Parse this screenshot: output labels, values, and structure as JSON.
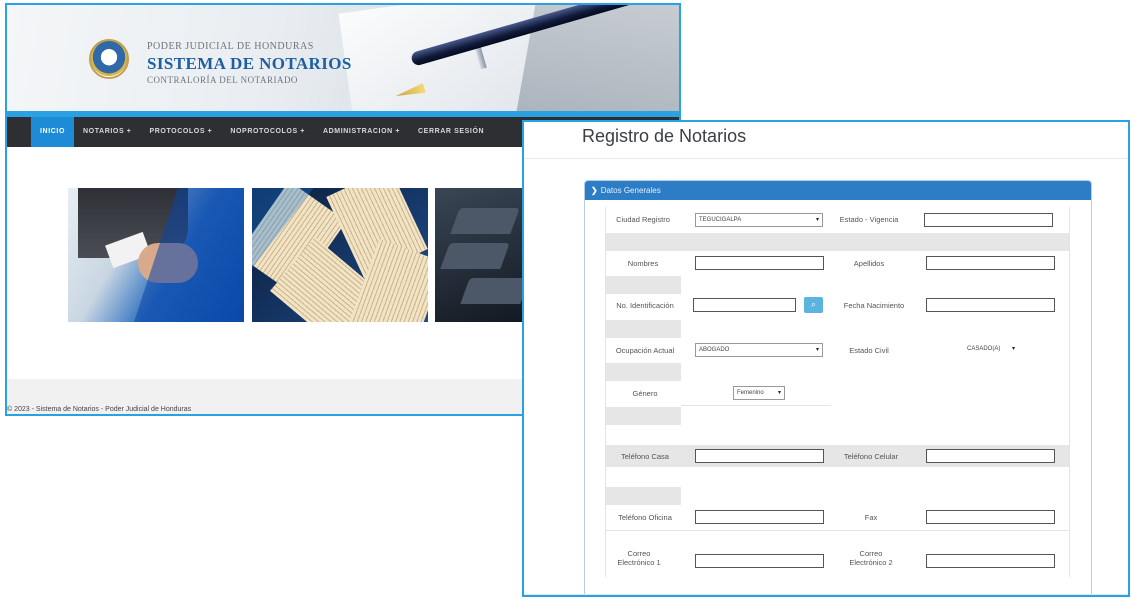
{
  "home": {
    "banner": {
      "org_line": "PODER JUDICIAL DE HONDURAS",
      "system_name": "SISTEMA DE NOTARIOS",
      "department": "CONTRALORÍA DEL NOTARIADO"
    },
    "nav": [
      {
        "label": "INICIO"
      },
      {
        "label": "NOTARIOS +"
      },
      {
        "label": "PROTOCOLOS +"
      },
      {
        "label": "NOPROTOCOLOS +"
      },
      {
        "label": "ADMINISTRACION +"
      },
      {
        "label": "CERRAR SESIÓN"
      }
    ],
    "footer": "© 2023 - Sistema de Notarios - Poder Judicial de Honduras"
  },
  "form": {
    "title": "Registro de Notarios",
    "section": "Datos Generales",
    "fields": {
      "ciudad_registro": {
        "label": "Ciudad Registro",
        "value": "TEGUCIGALPA"
      },
      "estado_vigencia": {
        "label": "Estado - Vigencia",
        "value": ""
      },
      "nombres": {
        "label": "Nombres",
        "value": ""
      },
      "apellidos": {
        "label": "Apellidos",
        "value": ""
      },
      "no_identificacion": {
        "label": "No. Identificación",
        "value": ""
      },
      "fecha_nacimiento": {
        "label": "Fecha Nacimiento",
        "value": ""
      },
      "ocupacion_actual": {
        "label": "Ocupación Actual",
        "value": "ABOGADO"
      },
      "estado_civil": {
        "label": "Estado Civil",
        "value": "CASADO(A)"
      },
      "genero": {
        "label": "Género",
        "value": "Femenino"
      },
      "telefono_casa": {
        "label": "Teléfono Casa",
        "value": ""
      },
      "telefono_celular": {
        "label": "Teléfono Celular",
        "value": ""
      },
      "telefono_oficina": {
        "label": "Teléfono Oficina",
        "value": ""
      },
      "fax": {
        "label": "Fax",
        "value": ""
      },
      "correo_1": {
        "label": "Correo Electrónico 1",
        "value": ""
      },
      "correo_2": {
        "label": "Correo Electrónico 2",
        "value": ""
      }
    },
    "icons": {
      "search_button": "search-icon",
      "section_toggle": "chevron-right-icon"
    },
    "colors": {
      "accent": "#2aa1e3",
      "nav_active": "#1e8bd6",
      "panel_header": "#2d7cc6"
    }
  }
}
